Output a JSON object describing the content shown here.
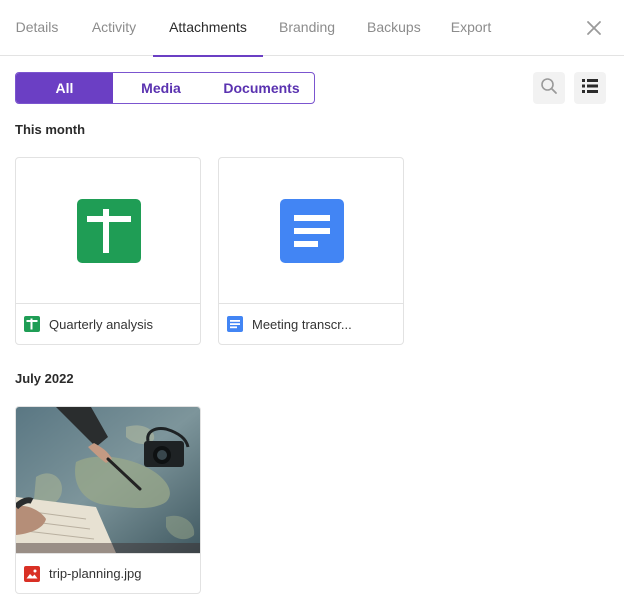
{
  "tabs": [
    {
      "label": "Details",
      "active": false
    },
    {
      "label": "Activity",
      "active": false
    },
    {
      "label": "Attachments",
      "active": true
    },
    {
      "label": "Branding",
      "active": false
    },
    {
      "label": "Backups",
      "active": false
    },
    {
      "label": "Export",
      "active": false
    }
  ],
  "filter": {
    "all_label": "All",
    "media_label": "Media",
    "documents_label": "Documents",
    "selected": "All"
  },
  "sections": [
    {
      "title": "This month",
      "items": [
        {
          "name": "Quarterly analysis",
          "type": "spreadsheet",
          "icon": "spreadsheet-icon"
        },
        {
          "name": "Meeting transcr...",
          "type": "document",
          "icon": "document-icon"
        }
      ]
    },
    {
      "title": "July 2022",
      "items": [
        {
          "name": "trip-planning.jpg",
          "type": "image",
          "icon": "image-icon"
        }
      ]
    }
  ],
  "colors": {
    "accent": "#6b3fc4",
    "spreadsheet": "#1f9d55",
    "document": "#4285f4",
    "image": "#d93025"
  }
}
